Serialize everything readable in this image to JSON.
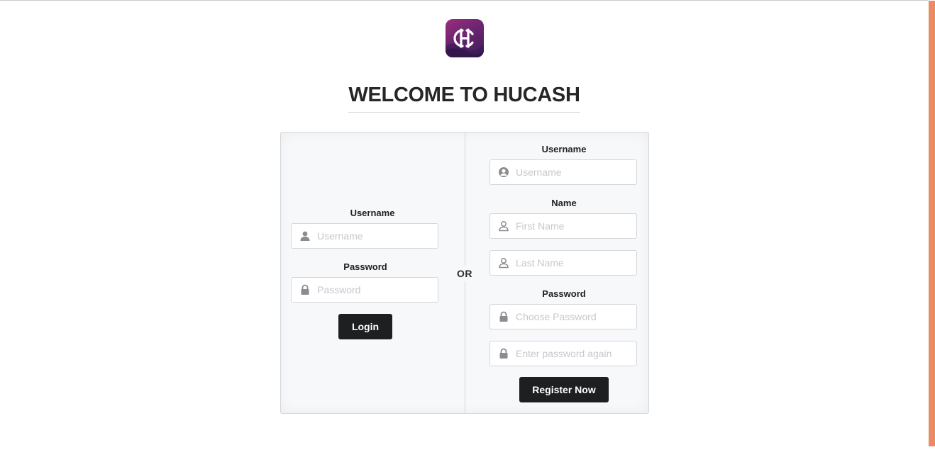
{
  "brand": {
    "logo_name": "hucash-logo",
    "colors": {
      "logo_top": "#9b2e7e",
      "logo_bottom": "#3e1d5a",
      "scroll_accent": "#ea8c63"
    }
  },
  "page": {
    "title": "WELCOME TO HUCASH"
  },
  "login": {
    "username_label": "Username",
    "username_placeholder": "Username",
    "password_label": "Password",
    "password_placeholder": "Password",
    "submit_label": "Login"
  },
  "separator": {
    "text": "OR"
  },
  "register": {
    "username_label": "Username",
    "username_placeholder": "Username",
    "name_label": "Name",
    "first_name_placeholder": "First Name",
    "last_name_placeholder": "Last Name",
    "password_label": "Password",
    "password_placeholder": "Choose Password",
    "password_confirm_placeholder": "Enter password again",
    "submit_label": "Register Now"
  },
  "icons": {
    "user": "user-icon",
    "user_circle": "user-circle-icon",
    "user_outline": "user-outline-icon",
    "lock": "lock-icon"
  }
}
